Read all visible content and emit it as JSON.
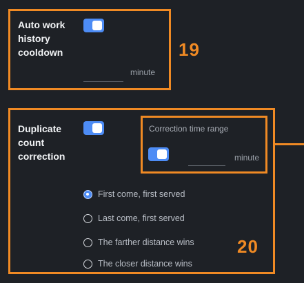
{
  "section19": {
    "label": "Auto work\nhistory\ncooldown",
    "toggle_on": true,
    "input_value": "",
    "unit": "minute",
    "number": "19"
  },
  "section20": {
    "label": "Duplicate\ncount\ncorrection",
    "toggle_on": true,
    "correction": {
      "caption": "Correction time range",
      "toggle_on": true,
      "input_value": "",
      "unit": "minute"
    },
    "options": [
      {
        "label": "First come, first served",
        "selected": true
      },
      {
        "label": "Last come, first served",
        "selected": false
      },
      {
        "label": "The farther distance wins",
        "selected": false
      },
      {
        "label": "The closer distance wins",
        "selected": false
      }
    ],
    "number": "20"
  },
  "colors": {
    "accent": "#f08a24",
    "toggle": "#4d8cf5",
    "background": "#1e2126"
  }
}
